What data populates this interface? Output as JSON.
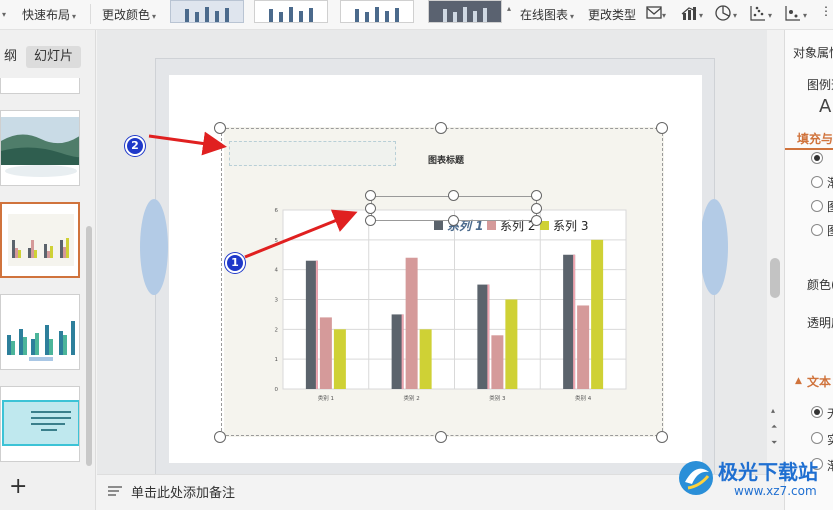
{
  "toolbar": {
    "quick_layout": "快速布局",
    "change_color": "更改颜色",
    "online_chart": "在线图表",
    "change_type": "更改类型"
  },
  "left_panel": {
    "tab_outline": "纲",
    "tab_slides": "幻灯片",
    "add_slide": "+"
  },
  "notes": {
    "placeholder": "单击此处添加备注"
  },
  "right_panel": {
    "title": "对象属性",
    "legend_section": "图例选",
    "fill_line": "填充与",
    "fill_opts": [
      "",
      "渐",
      "图",
      "图"
    ],
    "color_label": "颜色(",
    "transparency_label": "透明度",
    "text_section": "文本",
    "text_opts": [
      "无",
      "实",
      "渐"
    ]
  },
  "chart_data": {
    "type": "bar",
    "title": "图表标题",
    "categories": [
      "类别 1",
      "类别 2",
      "类别 3",
      "类别 4"
    ],
    "series": [
      {
        "name": "系列 1",
        "values": [
          4.3,
          2.5,
          3.5,
          4.5
        ],
        "color": "#5b636c"
      },
      {
        "name": "系列 2",
        "values": [
          2.4,
          4.4,
          1.8,
          2.8
        ],
        "color": "#d59a9a"
      },
      {
        "name": "系列 3",
        "values": [
          2,
          2,
          3,
          5
        ],
        "color": "#cfd135"
      }
    ],
    "ylim": [
      0,
      6
    ],
    "yticks": [
      "0",
      "1",
      "2",
      "3",
      "4",
      "5",
      "6"
    ],
    "legend_position": "top",
    "grid": true
  },
  "annotations": [
    "1",
    "2"
  ],
  "watermark": {
    "text": "极光下载站",
    "url": "www.xz7.com"
  },
  "colors": {
    "accent": "#d0733c",
    "annotation": "#1f39c9",
    "arrow": "#e02020"
  }
}
